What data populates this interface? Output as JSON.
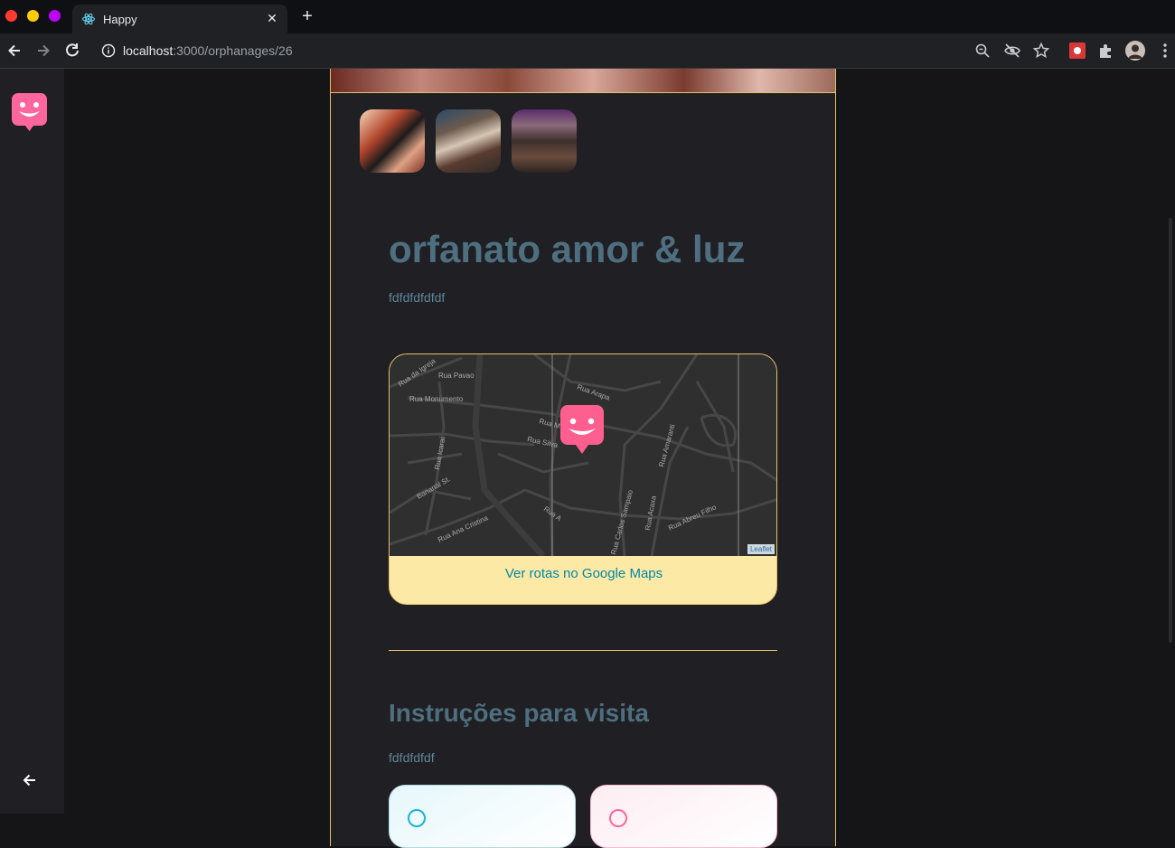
{
  "browser": {
    "tab_title": "Happy",
    "url_host": "localhost",
    "url_path": ":3000/orphanages/26"
  },
  "orphanage": {
    "name": "orfanato amor & luz",
    "about": "fdfdfdfdfdf",
    "map_link": "Ver rotas no Google Maps",
    "map_attribution": "Leaflet",
    "instructions_title": "Instruções para visita",
    "instructions": "fdfdfdfdf"
  },
  "map_streets": [
    "Rua da Igreja",
    "Rua Pavao",
    "Rua Monumento",
    "Rua Arapa",
    "Rua M",
    "Rua Silva",
    "Rua Icaraí",
    "Bananal St.",
    "Rua Amaranti",
    "Rua A",
    "Rua Ana Cristina",
    "Rua Acaxa",
    "Rua Abreu Filho",
    "Rua Carlos Sampaio"
  ],
  "colors": {
    "brand": "#ff669d",
    "accent_border": "#e4c06a",
    "title": "#4d6f80",
    "link": "#0089a5"
  },
  "icons": [
    "react-icon",
    "back-arrow-icon",
    "forward-arrow-icon",
    "reload-icon",
    "info-icon",
    "zoom-icon",
    "eye-off-icon",
    "star-icon",
    "extension-icon",
    "puzzle-icon",
    "profile-icon",
    "menu-icon",
    "happy-logo-icon",
    "map-marker-icon",
    "clock-icon",
    "info-circle-icon"
  ]
}
